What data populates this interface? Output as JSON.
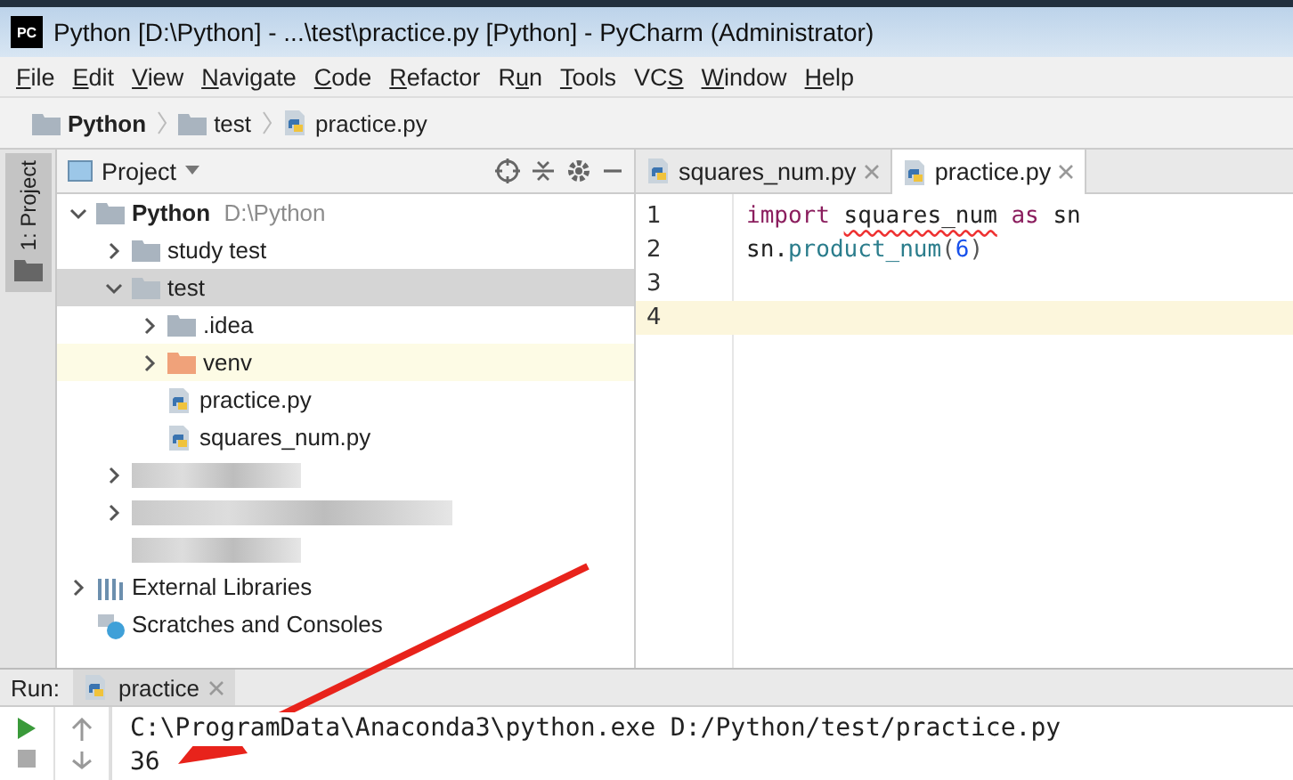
{
  "window": {
    "title": "Python [D:\\Python] - ...\\test\\practice.py [Python] - PyCharm (Administrator)"
  },
  "app_logo": "PC",
  "menu": [
    {
      "key": "F",
      "post": "ile"
    },
    {
      "key": "E",
      "post": "dit"
    },
    {
      "key": "V",
      "post": "iew"
    },
    {
      "key": "N",
      "post": "avigate"
    },
    {
      "key": "C",
      "post": "ode"
    },
    {
      "key": "R",
      "post": "efactor"
    },
    {
      "pre": "R",
      "key": "u",
      "post": "n"
    },
    {
      "key": "T",
      "post": "ools"
    },
    {
      "pre": "VC",
      "key": "S"
    },
    {
      "key": "W",
      "post": "indow"
    },
    {
      "key": "H",
      "post": "elp"
    }
  ],
  "breadcrumb": [
    {
      "label": "Python",
      "kind": "root"
    },
    {
      "label": "test",
      "kind": "folder"
    },
    {
      "label": "practice.py",
      "kind": "python"
    }
  ],
  "side_strip": {
    "label": "1: Project"
  },
  "project_panel": {
    "title": "Project"
  },
  "tree": [
    {
      "label": "Python",
      "path": "D:\\Python",
      "kind": "root",
      "expanded": true,
      "selected": false,
      "children": [
        {
          "label": "study test",
          "kind": "folder",
          "expanded": false,
          "selected": false
        },
        {
          "label": "test",
          "kind": "package",
          "expanded": true,
          "selected": true,
          "children": [
            {
              "label": ".idea",
              "kind": "folder",
              "expanded": false,
              "selected": false
            },
            {
              "label": "venv",
              "kind": "excluded",
              "expanded": false,
              "selected": false,
              "highlighted": true
            },
            {
              "label": "practice.py",
              "kind": "python",
              "selected": false
            },
            {
              "label": "squares_num.py",
              "kind": "python",
              "selected": false
            }
          ]
        },
        {
          "kind": "redacted",
          "expanded": false,
          "selected": false
        },
        {
          "kind": "redacted",
          "expanded": false,
          "selected": false
        },
        {
          "kind": "redacted",
          "selected": false
        }
      ]
    },
    {
      "label": "External Libraries",
      "kind": "libraries",
      "expanded": false,
      "selected": false
    },
    {
      "label": "Scratches and Consoles",
      "kind": "scratches",
      "selected": false
    }
  ],
  "editor_tabs": [
    {
      "label": "squares_num.py",
      "selected": false
    },
    {
      "label": "practice.py",
      "selected": true
    }
  ],
  "code_lines": [
    {
      "number": "1",
      "current": false,
      "tokens": [
        {
          "text": "import",
          "kind": "keyword"
        },
        {
          "text": "squares_num",
          "kind": "error",
          "space_before": true
        },
        {
          "text": "as",
          "kind": "keyword",
          "space_before": true
        },
        {
          "text": "sn",
          "kind": "plain",
          "space_before": true
        }
      ]
    },
    {
      "number": "2",
      "current": false,
      "tokens": [
        {
          "text": "sn.",
          "kind": "plain"
        },
        {
          "text": "product_num",
          "kind": "call"
        },
        {
          "text": "(",
          "kind": "paren"
        },
        {
          "text": "6",
          "kind": "number"
        },
        {
          "text": ")",
          "kind": "paren"
        }
      ]
    },
    {
      "number": "3",
      "current": false
    },
    {
      "number": "4",
      "current": true
    }
  ],
  "run_panel": {
    "label": "Run:",
    "tab": {
      "label": "practice",
      "selected": true
    },
    "output": [
      "C:\\ProgramData\\Anaconda3\\python.exe D:/Python/test/practice.py",
      "36"
    ]
  }
}
